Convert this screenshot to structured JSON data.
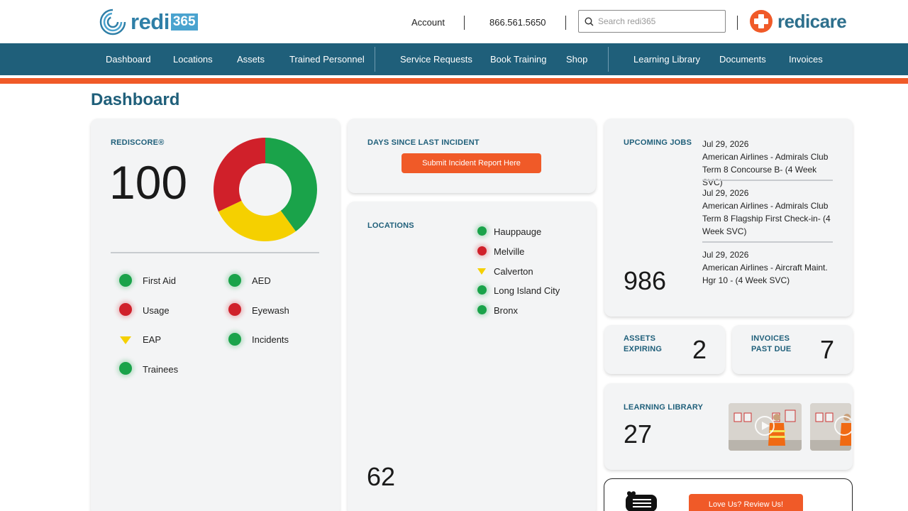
{
  "header": {
    "logo_word": "redi",
    "logo_num": "365",
    "account": "Account",
    "phone": "866.561.5650",
    "search_placeholder": "Search redi365",
    "partner_logo": "redicare"
  },
  "nav": {
    "items": [
      "Dashboard",
      "Locations",
      "Assets",
      "Trained Personnel",
      "Service Requests",
      "Book Training",
      "Shop",
      "Learning Library",
      "Documents",
      "Invoices"
    ]
  },
  "page_title": "Dashboard",
  "rediscore": {
    "title": "REDISCORE®",
    "value": "100",
    "donut": {
      "green": 0.4,
      "yellow": 0.28,
      "red": 0.32
    },
    "stats": [
      {
        "label": "First Aid",
        "status": "green"
      },
      {
        "label": "AED",
        "status": "green"
      },
      {
        "label": "Usage",
        "status": "red"
      },
      {
        "label": "Eyewash",
        "status": "red"
      },
      {
        "label": "EAP",
        "status": "yellow"
      },
      {
        "label": "Incidents",
        "status": "green"
      },
      {
        "label": "Trainees",
        "status": "green"
      }
    ]
  },
  "incident": {
    "title": "DAYS SINCE LAST INCIDENT",
    "button": "Submit Incident Report Here"
  },
  "locations": {
    "title": "LOCATIONS",
    "count": "62",
    "items": [
      {
        "name": "Hauppauge",
        "status": "green"
      },
      {
        "name": "Melville",
        "status": "red"
      },
      {
        "name": "Calverton",
        "status": "yellow"
      },
      {
        "name": "Long Island City",
        "status": "green"
      },
      {
        "name": "Bronx",
        "status": "green"
      }
    ]
  },
  "jobs": {
    "title": "UPCOMING JOBS",
    "count": "986",
    "items": [
      {
        "date": "Jul 29, 2026",
        "desc": "American Airlines - Admirals Club Term 8 Concourse B- (4 Week SVC)"
      },
      {
        "date": "Jul 29, 2026",
        "desc": "American Airlines - Admirals Club Term 8 Flagship First Check-in- (4 Week SVC)"
      },
      {
        "date": "Jul 29, 2026",
        "desc": "American Airlines - Aircraft Maint. Hgr 10 - (4 Week SVC)"
      }
    ]
  },
  "assets": {
    "title_1": "ASSETS",
    "title_2": "EXPIRING",
    "value": "2"
  },
  "invoices": {
    "title_1": "INVOICES",
    "title_2": "PAST DUE",
    "value": "7"
  },
  "learning": {
    "title": "LEARNING LIBRARY",
    "count": "27"
  },
  "review": {
    "button": "Love Us? Review Us!"
  },
  "colors": {
    "brand": "#1f5f7a",
    "accent": "#f05a28",
    "green": "#1aa34a",
    "red": "#d0202a",
    "yellow": "#f5d000"
  }
}
